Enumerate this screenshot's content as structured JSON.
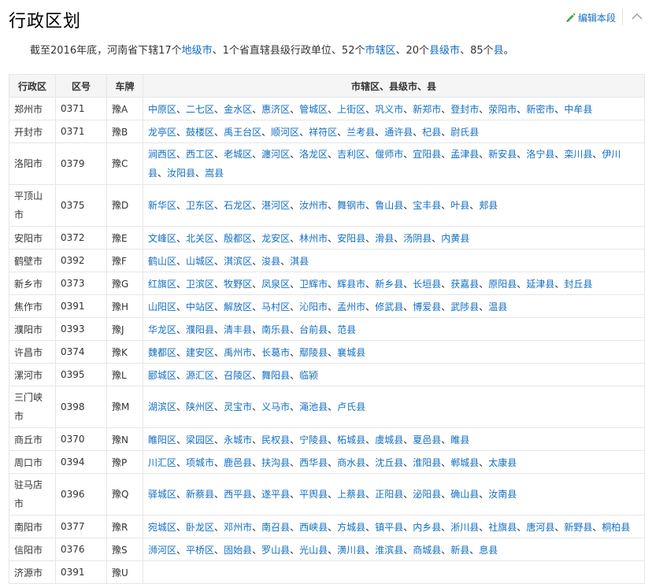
{
  "section": {
    "title": "行政区划",
    "edit_label": "编辑本段"
  },
  "intro": {
    "t1": "截至2016年底，河南省下辖17个",
    "l1": "地级市",
    "t2": "、1个省直辖县级行政单位、52个",
    "l2": "市辖区",
    "t3": "、20个",
    "l3": "县级市",
    "t4": "、85个",
    "l4": "县",
    "t5": "。"
  },
  "table": {
    "headers": [
      "行政区",
      "区号",
      "车牌",
      "市辖区、县级市、县"
    ],
    "rows": [
      {
        "region": "郑州市",
        "code": "0371",
        "plate": "豫A",
        "areas": [
          "中原区",
          "二七区",
          "金水区",
          "惠济区",
          "管城区",
          "上街区",
          "巩义市",
          "新郑市",
          "登封市",
          "荥阳市",
          "新密市",
          "中牟县"
        ]
      },
      {
        "region": "开封市",
        "code": "0371",
        "plate": "豫B",
        "areas": [
          "龙亭区",
          "鼓楼区",
          "禹王台区",
          "顺河区",
          "祥符区",
          "兰考县",
          "通许县",
          "杞县",
          "尉氏县"
        ]
      },
      {
        "region": "洛阳市",
        "code": "0379",
        "plate": "豫C",
        "areas": [
          "涧西区",
          "西工区",
          "老城区",
          "瀍河区",
          "洛龙区",
          "吉利区",
          "偃师市",
          "宜阳县",
          "孟津县",
          "新安县",
          "洛宁县",
          "栾川县",
          "伊川县",
          "汝阳县",
          "嵩县"
        ]
      },
      {
        "region": "平顶山市",
        "code": "0375",
        "plate": "豫D",
        "areas": [
          "新华区",
          "卫东区",
          "石龙区",
          "湛河区",
          "汝州市",
          "舞钢市",
          "鲁山县",
          "宝丰县",
          "叶县",
          "郏县"
        ]
      },
      {
        "region": "安阳市",
        "code": "0372",
        "plate": "豫E",
        "areas": [
          "文峰区",
          "北关区",
          "殷都区",
          "龙安区",
          "林州市",
          "安阳县",
          "滑县",
          "汤阴县",
          "内黄县"
        ]
      },
      {
        "region": "鹤壁市",
        "code": "0392",
        "plate": "豫F",
        "areas": [
          "鹤山区",
          "山城区",
          "淇滨区",
          "浚县",
          "淇县"
        ]
      },
      {
        "region": "新乡市",
        "code": "0373",
        "plate": "豫G",
        "areas": [
          "红旗区",
          "卫滨区",
          "牧野区",
          "凤泉区",
          "卫辉市",
          "辉县市",
          "新乡县",
          "长垣县",
          "获嘉县",
          "原阳县",
          "延津县",
          "封丘县"
        ]
      },
      {
        "region": "焦作市",
        "code": "0391",
        "plate": "豫H",
        "areas": [
          "山阳区",
          "中站区",
          "解放区",
          "马村区",
          "沁阳市",
          "孟州市",
          "修武县",
          "博爱县",
          "武陟县",
          "温县"
        ]
      },
      {
        "region": "濮阳市",
        "code": "0393",
        "plate": "豫J",
        "areas": [
          "华龙区",
          "濮阳县",
          "清丰县",
          "南乐县",
          "台前县",
          "范县"
        ]
      },
      {
        "region": "许昌市",
        "code": "0374",
        "plate": "豫K",
        "areas": [
          "魏都区",
          "建安区",
          "禹州市",
          "长葛市",
          "鄢陵县",
          "襄城县"
        ]
      },
      {
        "region": "漯河市",
        "code": "0395",
        "plate": "豫L",
        "areas": [
          "郾城区",
          "源汇区",
          "召陵区",
          "舞阳县",
          "临颍"
        ]
      },
      {
        "region": "三门峡市",
        "code": "0398",
        "plate": "豫M",
        "areas": [
          "湖滨区",
          "陕州区",
          "灵宝市",
          "义马市",
          "渑池县",
          "卢氏县"
        ]
      },
      {
        "region": "商丘市",
        "code": "0370",
        "plate": "豫N",
        "areas": [
          "睢阳区",
          "梁园区",
          "永城市",
          "民权县",
          "宁陵县",
          "柘城县",
          "虞城县",
          "夏邑县",
          "睢县"
        ]
      },
      {
        "region": "周口市",
        "code": "0394",
        "plate": "豫P",
        "areas": [
          "川汇区",
          "项城市",
          "鹿邑县",
          "扶沟县",
          "西华县",
          "商水县",
          "沈丘县",
          "淮阳县",
          "郸城县",
          "太康县"
        ]
      },
      {
        "region": "驻马店市",
        "code": "0396",
        "plate": "豫Q",
        "areas": [
          "驿城区",
          "新蔡县",
          "西平县",
          "遂平县",
          "平舆县",
          "上蔡县",
          "正阳县",
          "泌阳县",
          "确山县",
          "汝南县"
        ]
      },
      {
        "region": "南阳市",
        "code": "0377",
        "plate": "豫R",
        "areas": [
          "宛城区",
          "卧龙区",
          "邓州市",
          "南召县",
          "西峡县",
          "方城县",
          "镇平县",
          "内乡县",
          "淅川县",
          "社旗县",
          "唐河县",
          "新野县",
          "桐柏县"
        ]
      },
      {
        "region": "信阳市",
        "code": "0376",
        "plate": "豫S",
        "areas": [
          "浉河区",
          "平桥区",
          "固始县",
          "罗山县",
          "光山县",
          "潢川县",
          "淮滨县",
          "商城县",
          "新县",
          "息县"
        ]
      },
      {
        "region": "济源市",
        "code": "0391",
        "plate": "豫U",
        "areas": []
      }
    ]
  },
  "colors": {
    "link": "#136ec2",
    "edit_icon": "#3ba44e",
    "header_bg": "#f5f5f5",
    "border": "#e6e6e6"
  },
  "icons": {
    "edit": "pencil-icon",
    "collapse": "chevron-up-icon"
  }
}
